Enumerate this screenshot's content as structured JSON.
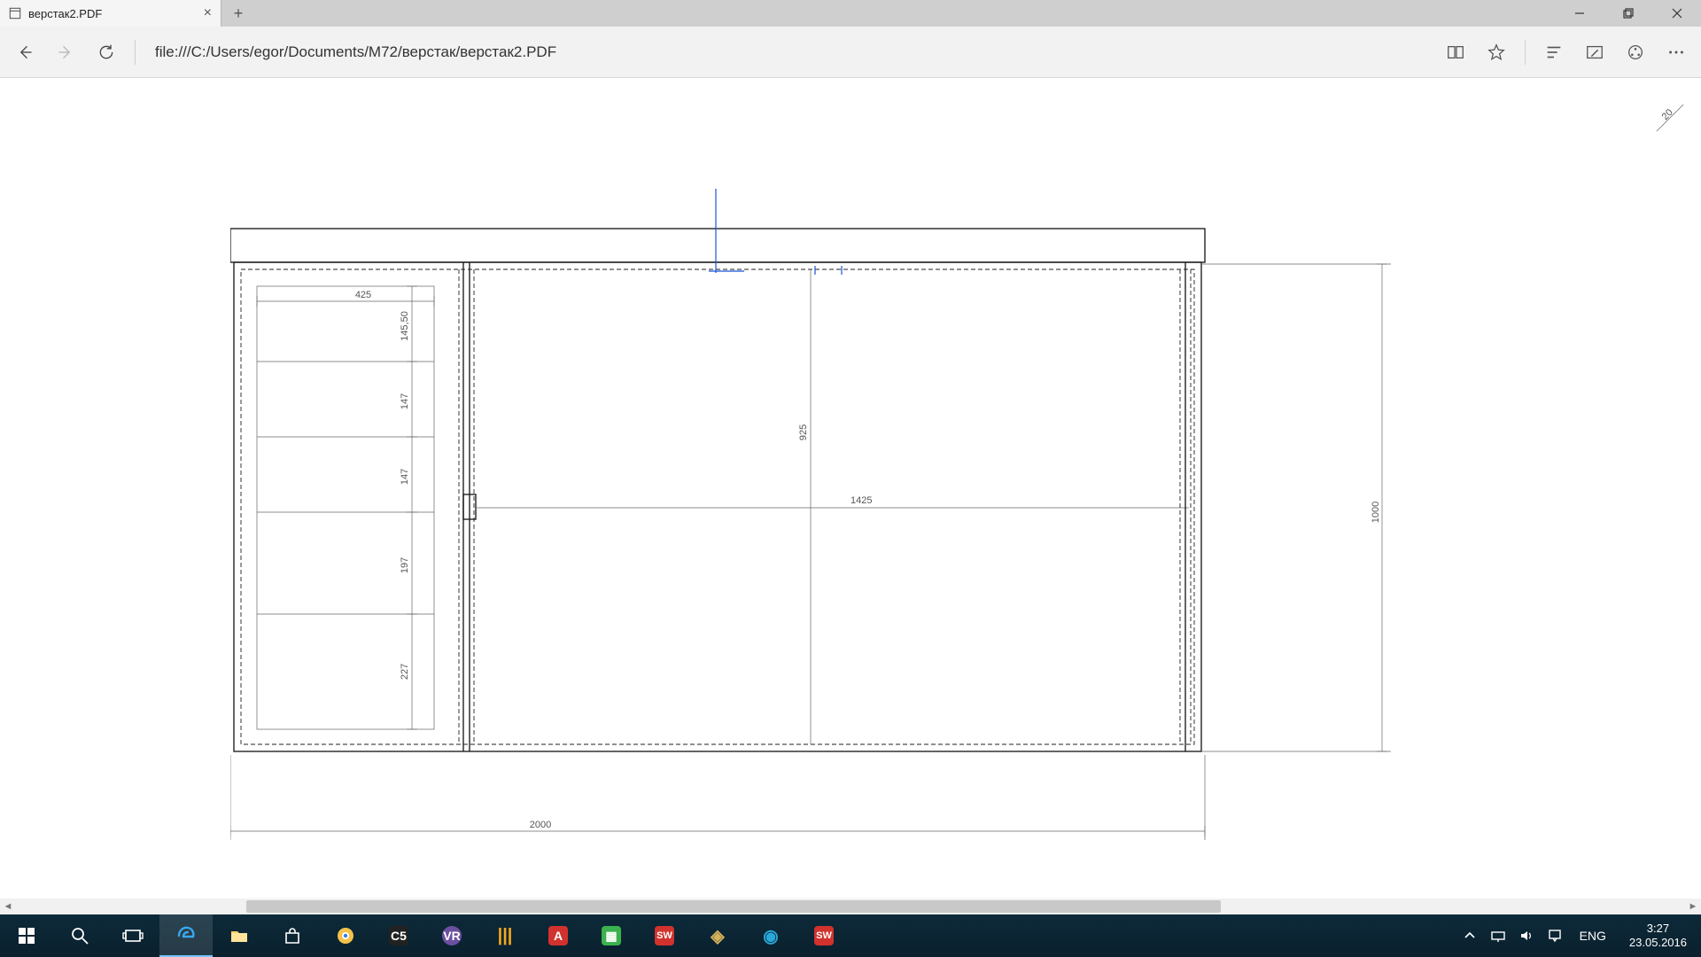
{
  "window": {
    "tab_title": "верстак2.PDF",
    "minimize_tip": "Minimize",
    "maximize_tip": "Restore",
    "close_tip": "Close"
  },
  "address": {
    "url": "file:///C:/Users/egor/Documents/M72/верстак/верстак2.PDF"
  },
  "pdf": {
    "page_corner_label": "20",
    "dimensions": {
      "overall_width": "2000",
      "overall_height": "1000",
      "right_section_width": "1425",
      "right_section_height": "925",
      "left_shelf_width": "425",
      "left_shelf_heights": [
        "145,50",
        "147",
        "147",
        "197",
        "227"
      ]
    }
  },
  "systray": {
    "language": "ENG",
    "time": "3:27",
    "date": "23.05.2016"
  },
  "taskbar_apps": [
    {
      "name": "start",
      "color": "#ffffff"
    },
    {
      "name": "search",
      "color": "#ffffff"
    },
    {
      "name": "task-view",
      "color": "#ffffff"
    },
    {
      "name": "edge",
      "color": "#39a0e8",
      "active": true
    },
    {
      "name": "file-explorer",
      "color": "#ffcc55"
    },
    {
      "name": "store",
      "color": "#ffffff"
    },
    {
      "name": "chrome",
      "color": "#f4c24a"
    },
    {
      "name": "app-c5",
      "color": "#ffffff",
      "label": "C5"
    },
    {
      "name": "app-vr",
      "color": "#6b4fa0",
      "label": "VR"
    },
    {
      "name": "app-bars",
      "color": "#f6a81d",
      "label": "|||"
    },
    {
      "name": "app-a",
      "color": "#d2322d",
      "label": "A"
    },
    {
      "name": "app-flag",
      "color": "#3cb24e",
      "label": "▦"
    },
    {
      "name": "solidworks-1",
      "color": "#d2322d",
      "label": "SW"
    },
    {
      "name": "app-diamond",
      "color": "#d8b25a",
      "label": "◈"
    },
    {
      "name": "app-circle",
      "color": "#2aa8d8",
      "label": "◉"
    },
    {
      "name": "solidworks-2",
      "color": "#d2322d",
      "label": "SW"
    }
  ]
}
